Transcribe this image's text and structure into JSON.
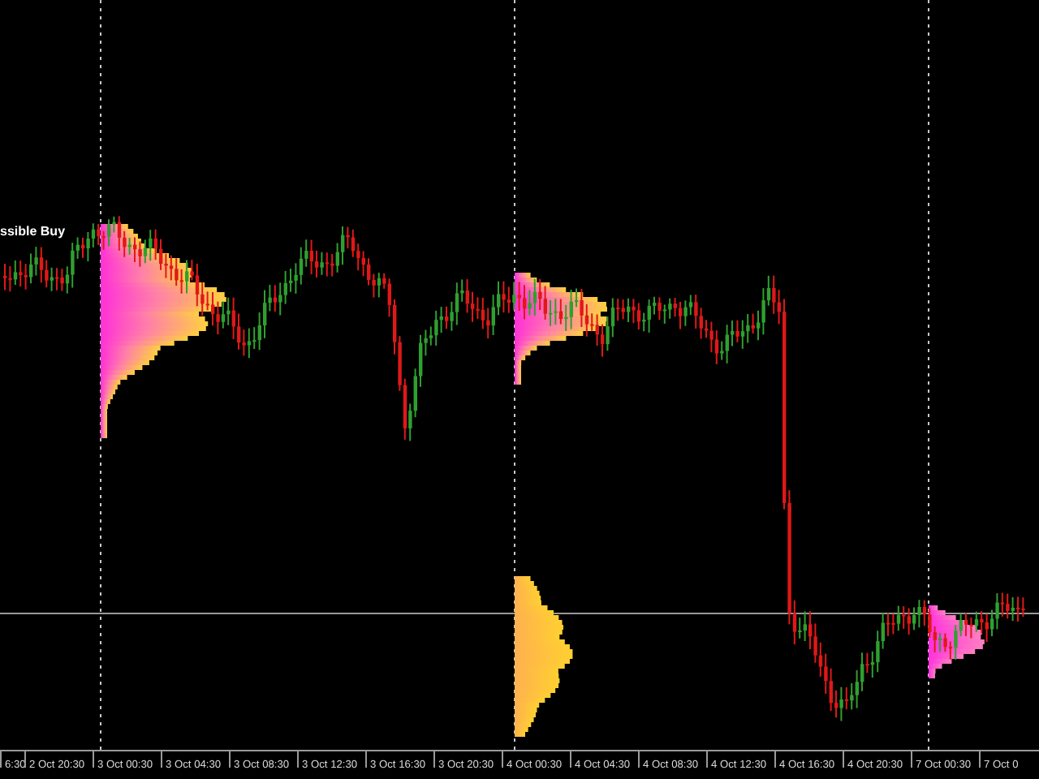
{
  "chart": {
    "signal_label": "ssible Buy"
  },
  "time_axis": {
    "labels": [
      "6:30",
      "2 Oct 20:30",
      "3 Oct 00:30",
      "3 Oct 04:30",
      "3 Oct 08:30",
      "3 Oct 12:30",
      "3 Oct 16:30",
      "3 Oct 20:30",
      "4 Oct 00:30",
      "4 Oct 04:30",
      "4 Oct 08:30",
      "4 Oct 12:30",
      "4 Oct 16:30",
      "4 Oct 20:30",
      "7 Oct 00:30",
      "7 Oct 0"
    ]
  }
}
